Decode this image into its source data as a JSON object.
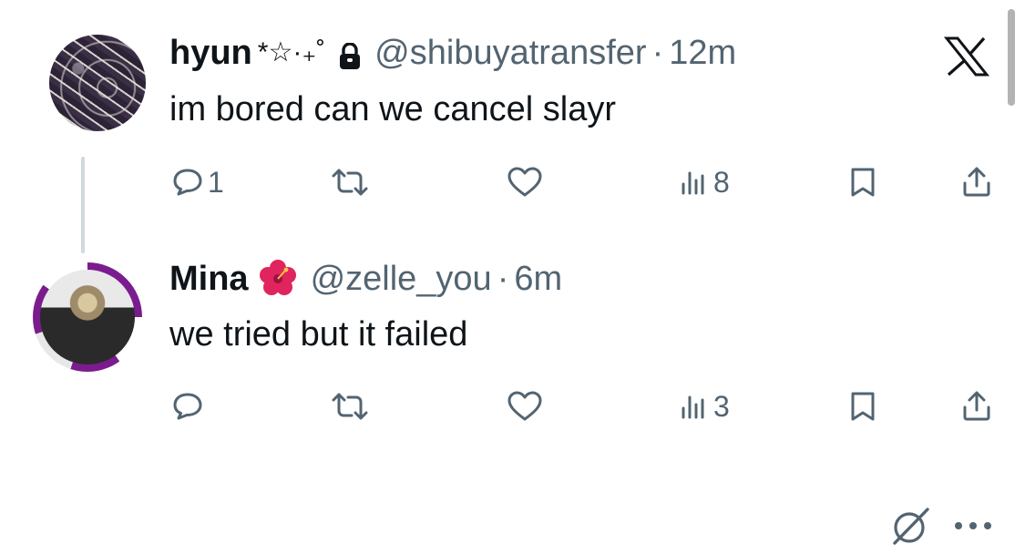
{
  "tweets": [
    {
      "display_name": "hyun",
      "name_decoration": "*☆·₊˚",
      "protected_icon": "lock-icon",
      "handle": "@shibuyatransfer",
      "separator": "·",
      "time": "12m",
      "text": "im bored can we cancel slayr",
      "reply_count": "1",
      "views": "8",
      "corner_icon": "x-logo-icon"
    },
    {
      "display_name": "Mina",
      "name_emoji": "hibiscus-emoji",
      "handle": "@zelle_you",
      "separator": "·",
      "time": "6m",
      "text": "we tried but it failed",
      "reply_count": "",
      "views": "3",
      "corner_icons": [
        "grok-icon",
        "more-icon"
      ]
    }
  ],
  "colors": {
    "text": "#0f1419",
    "secondary": "#536471",
    "thread_line": "#cfd9de",
    "avatar_ring": "#7b1c8e"
  }
}
